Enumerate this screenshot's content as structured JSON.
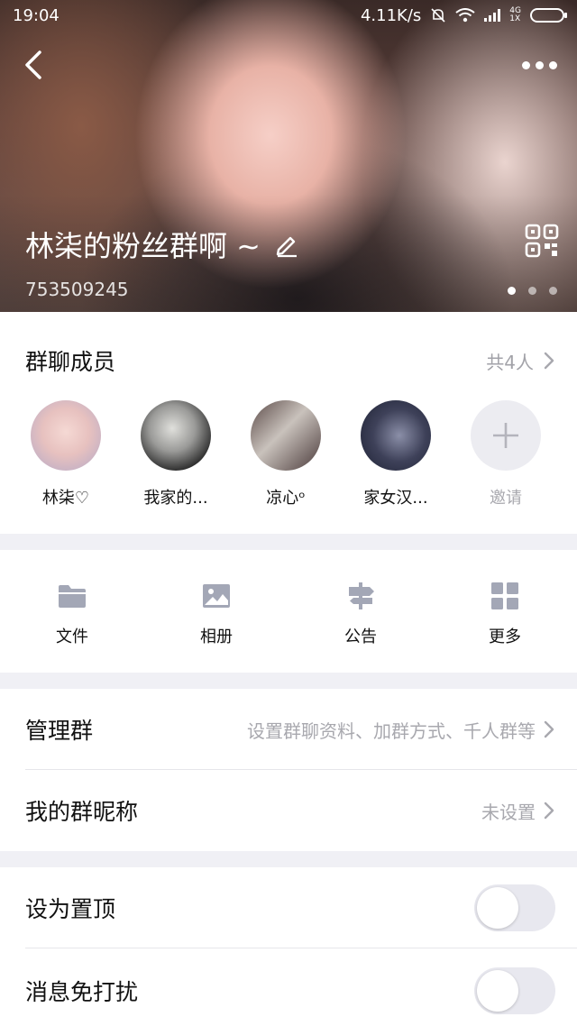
{
  "status_bar": {
    "time": "19:04",
    "net_speed": "4.11K/s",
    "network_top": "4G",
    "network_bottom": "1X"
  },
  "header": {
    "group_name": "林柒的粉丝群啊 ~",
    "group_id": "753509245",
    "photo_page": 1,
    "photo_count": 3
  },
  "members": {
    "title": "群聊成员",
    "count": "共4人",
    "items": [
      {
        "name": "林柒♡"
      },
      {
        "name": "我家的..."
      },
      {
        "name": "凉心ᵒ"
      },
      {
        "name": "家女汉..."
      }
    ],
    "invite_label": "邀请"
  },
  "tools": [
    {
      "label": "文件",
      "icon": "folder-icon"
    },
    {
      "label": "相册",
      "icon": "image-icon"
    },
    {
      "label": "公告",
      "icon": "signpost-icon"
    },
    {
      "label": "更多",
      "icon": "grid-icon"
    }
  ],
  "settings": {
    "manage_label": "管理群",
    "manage_value": "设置群聊资料、加群方式、千人群等",
    "nickname_label": "我的群昵称",
    "nickname_value": "未设置"
  },
  "toggles": {
    "pin_label": "设为置顶",
    "pin_on": false,
    "mute_label": "消息免打扰",
    "mute_on": false
  },
  "colors": {
    "accent_gray": "#a8a8ae",
    "icon_gray": "#a3a7b6",
    "switch_off": "#e8e8ef"
  }
}
